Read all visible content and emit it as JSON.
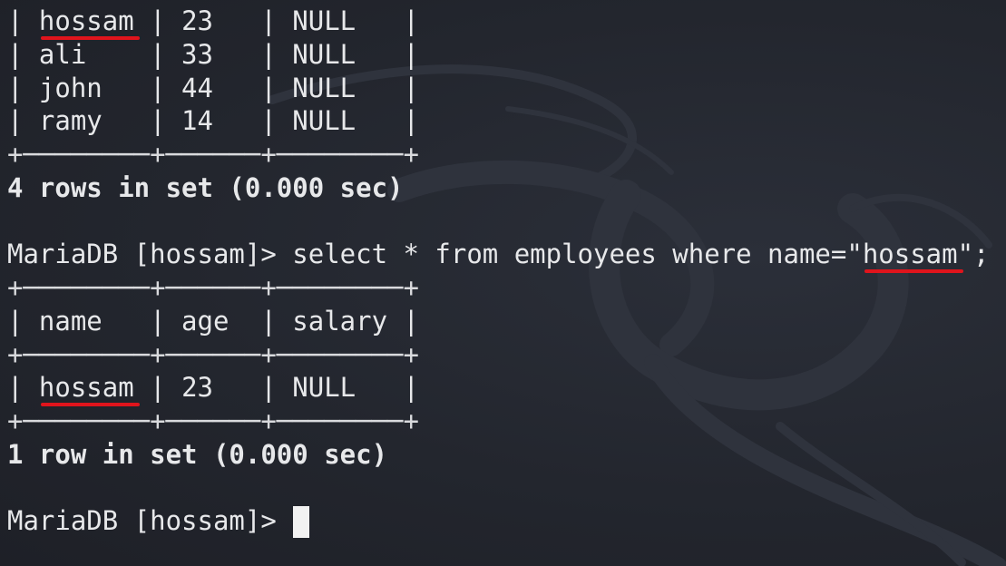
{
  "terminal": {
    "prompt": "MariaDB [hossam]> ",
    "lines": [
      {
        "pre": "| ",
        "highlight": "hossam",
        "post": " | 23   | NULL   |"
      },
      {
        "text": "| ali    | 33   | NULL   |"
      },
      {
        "text": "| john   | 44   | NULL   |"
      },
      {
        "text": "| ramy   | 14   | NULL   |"
      },
      {
        "text": "+────────+──────+────────+"
      },
      {
        "text": "4 rows in set (0.000 sec)"
      },
      {
        "text": ""
      },
      {
        "pre": "MariaDB [hossam]> select * from employees where name=\"",
        "highlight": "hossam",
        "post": "\";"
      },
      {
        "text": "+────────+──────+────────+"
      },
      {
        "text": "| name   | age  | salary |"
      },
      {
        "text": "+────────+──────+────────+"
      },
      {
        "pre": "| ",
        "highlight": "hossam",
        "post": " | 23   | NULL   |"
      },
      {
        "text": "+────────+──────+────────+"
      },
      {
        "text": "1 row in set (0.000 sec)"
      },
      {
        "text": ""
      },
      {
        "text": "MariaDB [hossam]> "
      }
    ]
  },
  "colors": {
    "background": "#23262e",
    "text": "#e7e8ea",
    "underline": "#e0141c",
    "cursor": "#f2f2f2"
  }
}
